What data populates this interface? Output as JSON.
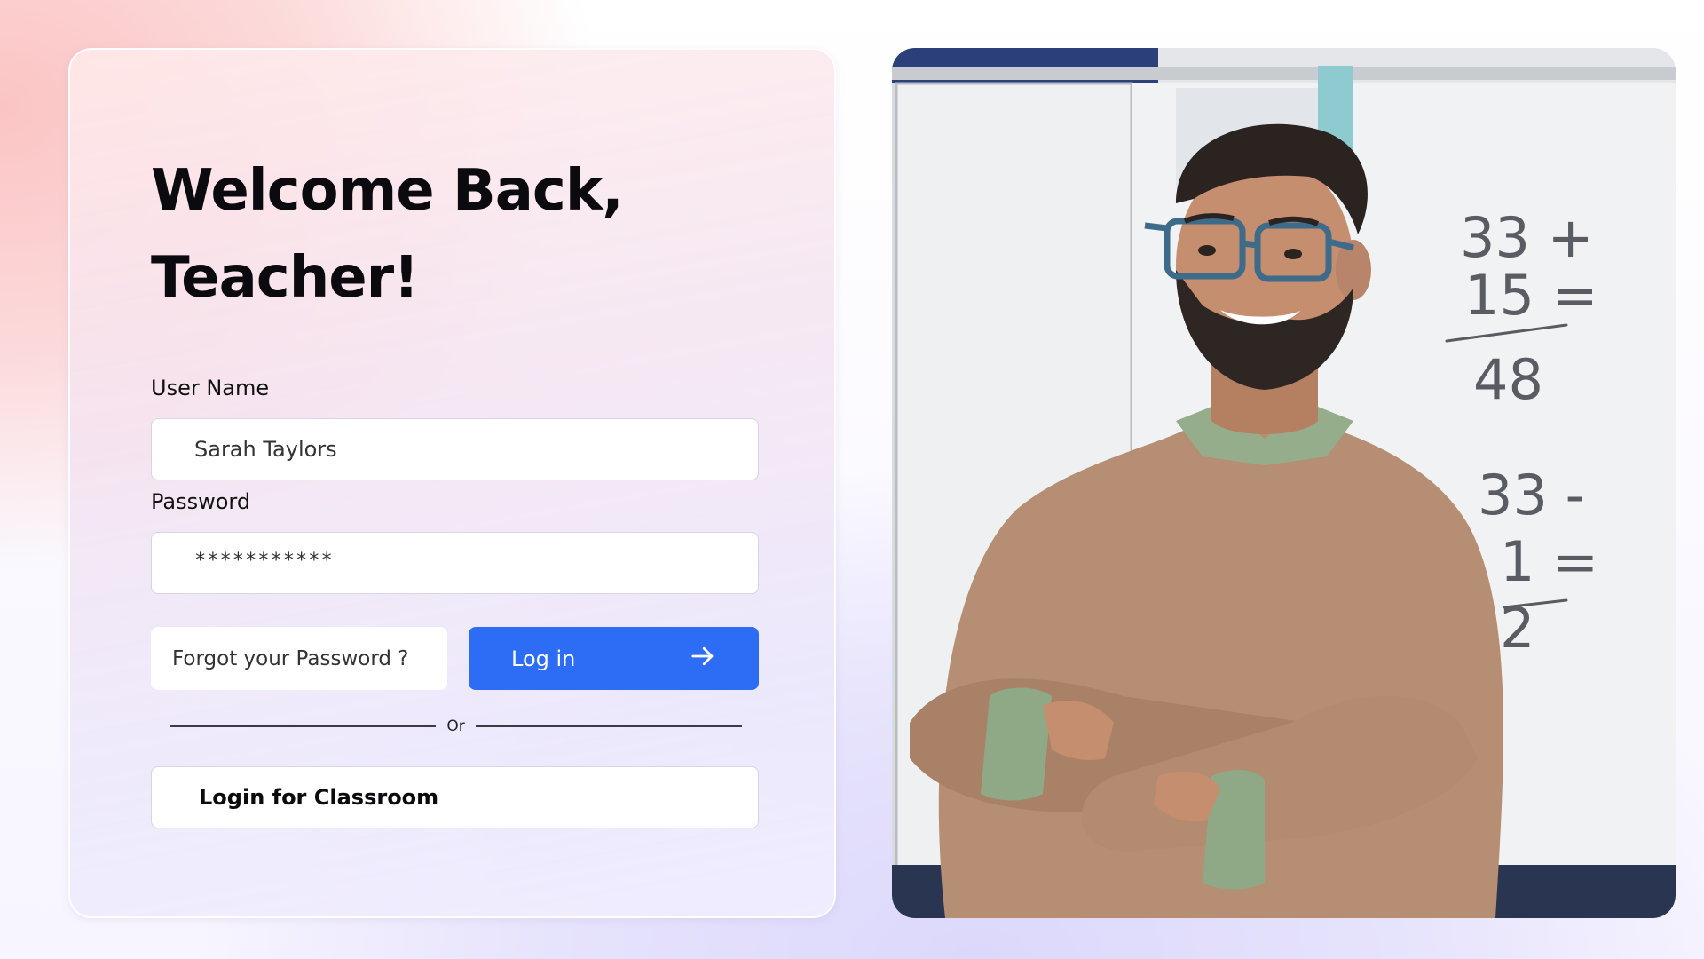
{
  "login": {
    "title_line1": "Welcome Back,",
    "title_line2": "Teacher!",
    "username_label": "User Name",
    "username_value": "Sarah Taylors",
    "password_label": "Password",
    "password_value": "***********",
    "forgot_label": "Forgot your Password  ?",
    "login_label": "Log in",
    "divider_text": "Or",
    "classroom_label": "Login for Classroom"
  },
  "photo": {
    "description_icon": "teacher-photo",
    "board_math": [
      "33 +",
      "15 =",
      "48",
      "33 -",
      "1 =",
      "2"
    ]
  },
  "colors": {
    "primary": "#2d6df6",
    "text": "#0b0b0f"
  }
}
